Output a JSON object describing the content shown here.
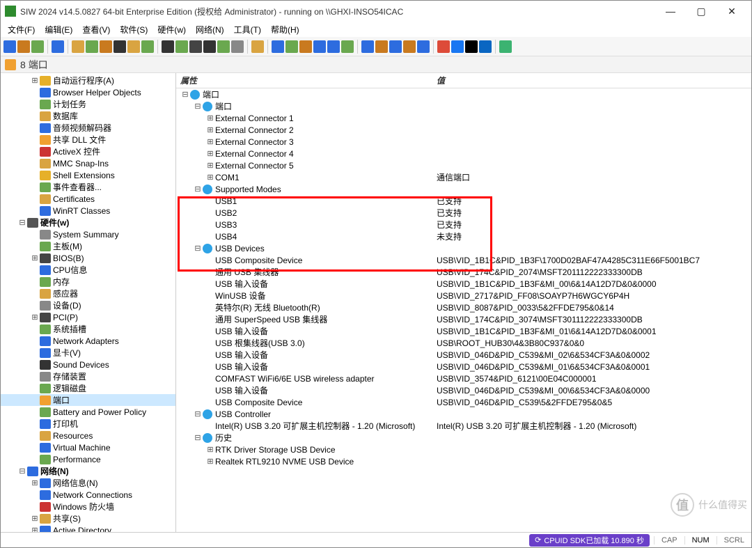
{
  "titlebar": {
    "text": "SIW 2024 v14.5.0827 64-bit Enterprise Edition (授权给 Administrator) - running on \\\\GHXI-INSO54ICAC"
  },
  "menus": [
    "文件(F)",
    "编辑(E)",
    "查看(V)",
    "软件(S)",
    "硬件(w)",
    "网络(N)",
    "工具(T)",
    "帮助(H)"
  ],
  "crumb": {
    "num": "8",
    "label": "端口"
  },
  "columns": {
    "attr": "属性",
    "val": "值"
  },
  "toolbar_colors": [
    "#2d6cdf",
    "#c97a1f",
    "#6aa84f",
    "#2d6cdf",
    "#d9a441",
    "#6aa84f",
    "#c97a1f",
    "#333333",
    "#d9a441",
    "#6aa84f",
    "#333333",
    "#6aa84f",
    "#444444",
    "#333333",
    "#6aa84f",
    "#888888",
    "#d9a441",
    "#2d6cdf",
    "#6aa84f",
    "#c97a1f",
    "#2d6cdf",
    "#2d6cdf",
    "#6aa84f",
    "#2d6cdf",
    "#c97a1f",
    "#2d6cdf",
    "#c97a1f",
    "#2d6cdf",
    "#dd4b39",
    "#1877f2",
    "#000000",
    "#0a66c2",
    "#3cb371"
  ],
  "sidebar": [
    {
      "depth": 2,
      "exp": "⊞",
      "ico": "#e6b029",
      "label": "自动运行程序(A)"
    },
    {
      "depth": 2,
      "exp": "",
      "ico": "#2d6cdf",
      "label": "Browser Helper Objects"
    },
    {
      "depth": 2,
      "exp": "",
      "ico": "#6aa84f",
      "label": "计划任务"
    },
    {
      "depth": 2,
      "exp": "",
      "ico": "#d9a441",
      "label": "数据库"
    },
    {
      "depth": 2,
      "exp": "",
      "ico": "#2d6cdf",
      "label": "音频视频解码器"
    },
    {
      "depth": 2,
      "exp": "",
      "ico": "#f0a030",
      "label": "共享 DLL 文件"
    },
    {
      "depth": 2,
      "exp": "",
      "ico": "#cc3333",
      "label": "ActiveX 控件"
    },
    {
      "depth": 2,
      "exp": "",
      "ico": "#d9a441",
      "label": "MMC Snap-Ins"
    },
    {
      "depth": 2,
      "exp": "",
      "ico": "#e6b029",
      "label": "Shell Extensions"
    },
    {
      "depth": 2,
      "exp": "",
      "ico": "#6aa84f",
      "label": "事件查看器..."
    },
    {
      "depth": 2,
      "exp": "",
      "ico": "#d9a441",
      "label": "Certificates"
    },
    {
      "depth": 2,
      "exp": "",
      "ico": "#2d6cdf",
      "label": "WinRT Classes"
    },
    {
      "depth": 1,
      "exp": "⊟",
      "ico": "#555555",
      "label": "硬件(w)",
      "bold": true
    },
    {
      "depth": 2,
      "exp": "",
      "ico": "#888888",
      "label": "System Summary"
    },
    {
      "depth": 2,
      "exp": "",
      "ico": "#6aa84f",
      "label": "主板(M)"
    },
    {
      "depth": 2,
      "exp": "⊞",
      "ico": "#444444",
      "label": "BIOS(B)"
    },
    {
      "depth": 2,
      "exp": "",
      "ico": "#2d6cdf",
      "label": "CPU信息"
    },
    {
      "depth": 2,
      "exp": "",
      "ico": "#6aa84f",
      "label": "内存"
    },
    {
      "depth": 2,
      "exp": "",
      "ico": "#d9a441",
      "label": "感应器"
    },
    {
      "depth": 2,
      "exp": "",
      "ico": "#888888",
      "label": "设备(D)"
    },
    {
      "depth": 2,
      "exp": "⊞",
      "ico": "#444444",
      "label": "PCI(P)"
    },
    {
      "depth": 2,
      "exp": "",
      "ico": "#6aa84f",
      "label": "系统插槽"
    },
    {
      "depth": 2,
      "exp": "",
      "ico": "#2d6cdf",
      "label": "Network Adapters"
    },
    {
      "depth": 2,
      "exp": "",
      "ico": "#2d6cdf",
      "label": "显卡(V)"
    },
    {
      "depth": 2,
      "exp": "",
      "ico": "#333333",
      "label": "Sound Devices"
    },
    {
      "depth": 2,
      "exp": "",
      "ico": "#888888",
      "label": "存储装置"
    },
    {
      "depth": 2,
      "exp": "",
      "ico": "#6aa84f",
      "label": "逻辑磁盘"
    },
    {
      "depth": 2,
      "exp": "",
      "ico": "#f0a030",
      "label": "端口",
      "sel": true
    },
    {
      "depth": 2,
      "exp": "",
      "ico": "#6aa84f",
      "label": "Battery and Power Policy"
    },
    {
      "depth": 2,
      "exp": "",
      "ico": "#2d6cdf",
      "label": "打印机"
    },
    {
      "depth": 2,
      "exp": "",
      "ico": "#d9a441",
      "label": "Resources"
    },
    {
      "depth": 2,
      "exp": "",
      "ico": "#2d6cdf",
      "label": "Virtual Machine"
    },
    {
      "depth": 2,
      "exp": "",
      "ico": "#6aa84f",
      "label": "Performance"
    },
    {
      "depth": 1,
      "exp": "⊟",
      "ico": "#2d6cdf",
      "label": "网络(N)",
      "bold": true
    },
    {
      "depth": 2,
      "exp": "⊞",
      "ico": "#2d6cdf",
      "label": "网络信息(N)"
    },
    {
      "depth": 2,
      "exp": "",
      "ico": "#2d6cdf",
      "label": "Network Connections"
    },
    {
      "depth": 2,
      "exp": "",
      "ico": "#cc3333",
      "label": "Windows 防火墙"
    },
    {
      "depth": 2,
      "exp": "⊞",
      "ico": "#d9a441",
      "label": "共享(S)"
    },
    {
      "depth": 2,
      "exp": "⊞",
      "ico": "#2d6cdf",
      "label": "Active Directory"
    }
  ],
  "grid": [
    {
      "depth": 0,
      "exp": "⊟",
      "ico": "#2ea3e6",
      "key": "端口",
      "val": ""
    },
    {
      "depth": 1,
      "exp": "⊟",
      "ico": "#2ea3e6",
      "key": "端口",
      "val": ""
    },
    {
      "depth": 2,
      "exp": "⊞",
      "ico": "",
      "key": "External Connector 1",
      "val": ""
    },
    {
      "depth": 2,
      "exp": "⊞",
      "ico": "",
      "key": "External Connector 2",
      "val": ""
    },
    {
      "depth": 2,
      "exp": "⊞",
      "ico": "",
      "key": "External Connector 3",
      "val": ""
    },
    {
      "depth": 2,
      "exp": "⊞",
      "ico": "",
      "key": "External Connector 4",
      "val": ""
    },
    {
      "depth": 2,
      "exp": "⊞",
      "ico": "",
      "key": "External Connector 5",
      "val": ""
    },
    {
      "depth": 2,
      "exp": "⊞",
      "ico": "",
      "key": "COM1",
      "val": "通信端口"
    },
    {
      "depth": 1,
      "exp": "⊟",
      "ico": "#2ea3e6",
      "key": "Supported Modes",
      "val": ""
    },
    {
      "depth": 2,
      "exp": "",
      "ico": "",
      "key": "USB1",
      "val": "已支持"
    },
    {
      "depth": 2,
      "exp": "",
      "ico": "",
      "key": "USB2",
      "val": "已支持"
    },
    {
      "depth": 2,
      "exp": "",
      "ico": "",
      "key": "USB3",
      "val": "已支持"
    },
    {
      "depth": 2,
      "exp": "",
      "ico": "",
      "key": "USB4",
      "val": "未支持"
    },
    {
      "depth": 1,
      "exp": "⊟",
      "ico": "#2ea3e6",
      "key": "USB Devices",
      "val": ""
    },
    {
      "depth": 2,
      "exp": "",
      "ico": "",
      "key": "USB Composite Device",
      "val": "USB\\VID_1B1C&PID_1B3F\\1700D02BAF47A4285C311E66F5001BC7"
    },
    {
      "depth": 2,
      "exp": "",
      "ico": "",
      "key": "通用 USB 集线器",
      "val": "USB\\VID_174C&PID_2074\\MSFT201112222333300DB"
    },
    {
      "depth": 2,
      "exp": "",
      "ico": "",
      "key": "USB 输入设备",
      "val": "USB\\VID_1B1C&PID_1B3F&MI_00\\6&14A12D7D&0&0000"
    },
    {
      "depth": 2,
      "exp": "",
      "ico": "",
      "key": "WinUSB 设备",
      "val": "USB\\VID_2717&PID_FF08\\SOAYP7H6WGCY6P4H"
    },
    {
      "depth": 2,
      "exp": "",
      "ico": "",
      "key": "英特尔(R) 无线 Bluetooth(R)",
      "val": "USB\\VID_8087&PID_0033\\5&2FFDE795&0&14"
    },
    {
      "depth": 2,
      "exp": "",
      "ico": "",
      "key": "通用 SuperSpeed USB 集线器",
      "val": "USB\\VID_174C&PID_3074\\MSFT301112222333300DB"
    },
    {
      "depth": 2,
      "exp": "",
      "ico": "",
      "key": "USB 输入设备",
      "val": "USB\\VID_1B1C&PID_1B3F&MI_01\\6&14A12D7D&0&0001"
    },
    {
      "depth": 2,
      "exp": "",
      "ico": "",
      "key": "USB 根集线器(USB 3.0)",
      "val": "USB\\ROOT_HUB30\\4&3B80C937&0&0"
    },
    {
      "depth": 2,
      "exp": "",
      "ico": "",
      "key": "USB 输入设备",
      "val": "USB\\VID_046D&PID_C539&MI_02\\6&534CF3A&0&0002"
    },
    {
      "depth": 2,
      "exp": "",
      "ico": "",
      "key": "USB 输入设备",
      "val": "USB\\VID_046D&PID_C539&MI_01\\6&534CF3A&0&0001"
    },
    {
      "depth": 2,
      "exp": "",
      "ico": "",
      "key": "COMFAST WiFi6/6E USB wireless adapter",
      "val": "USB\\VID_3574&PID_6121\\00E04C000001"
    },
    {
      "depth": 2,
      "exp": "",
      "ico": "",
      "key": "USB 输入设备",
      "val": "USB\\VID_046D&PID_C539&MI_00\\6&534CF3A&0&0000"
    },
    {
      "depth": 2,
      "exp": "",
      "ico": "",
      "key": "USB Composite Device",
      "val": "USB\\VID_046D&PID_C539\\5&2FFDE795&0&5"
    },
    {
      "depth": 1,
      "exp": "⊟",
      "ico": "#2ea3e6",
      "key": "USB Controller",
      "val": ""
    },
    {
      "depth": 2,
      "exp": "",
      "ico": "",
      "key": "Intel(R) USB 3.20 可扩展主机控制器 - 1.20 (Microsoft)",
      "val": "Intel(R) USB 3.20 可扩展主机控制器 - 1.20 (Microsoft)"
    },
    {
      "depth": 1,
      "exp": "⊟",
      "ico": "#2ea3e6",
      "key": "历史",
      "val": ""
    },
    {
      "depth": 2,
      "exp": "⊞",
      "ico": "",
      "key": "RTK Driver Storage USB Device",
      "val": ""
    },
    {
      "depth": 2,
      "exp": "⊞",
      "ico": "",
      "key": "Realtek RTL9210 NVME USB Device",
      "val": ""
    }
  ],
  "status": {
    "sdk": "CPUID SDK已加载 10.890 秒",
    "cap": "CAP",
    "num": "NUM",
    "scrl": "SCRL"
  },
  "watermark": {
    "char": "值",
    "text": "什么值得买"
  }
}
